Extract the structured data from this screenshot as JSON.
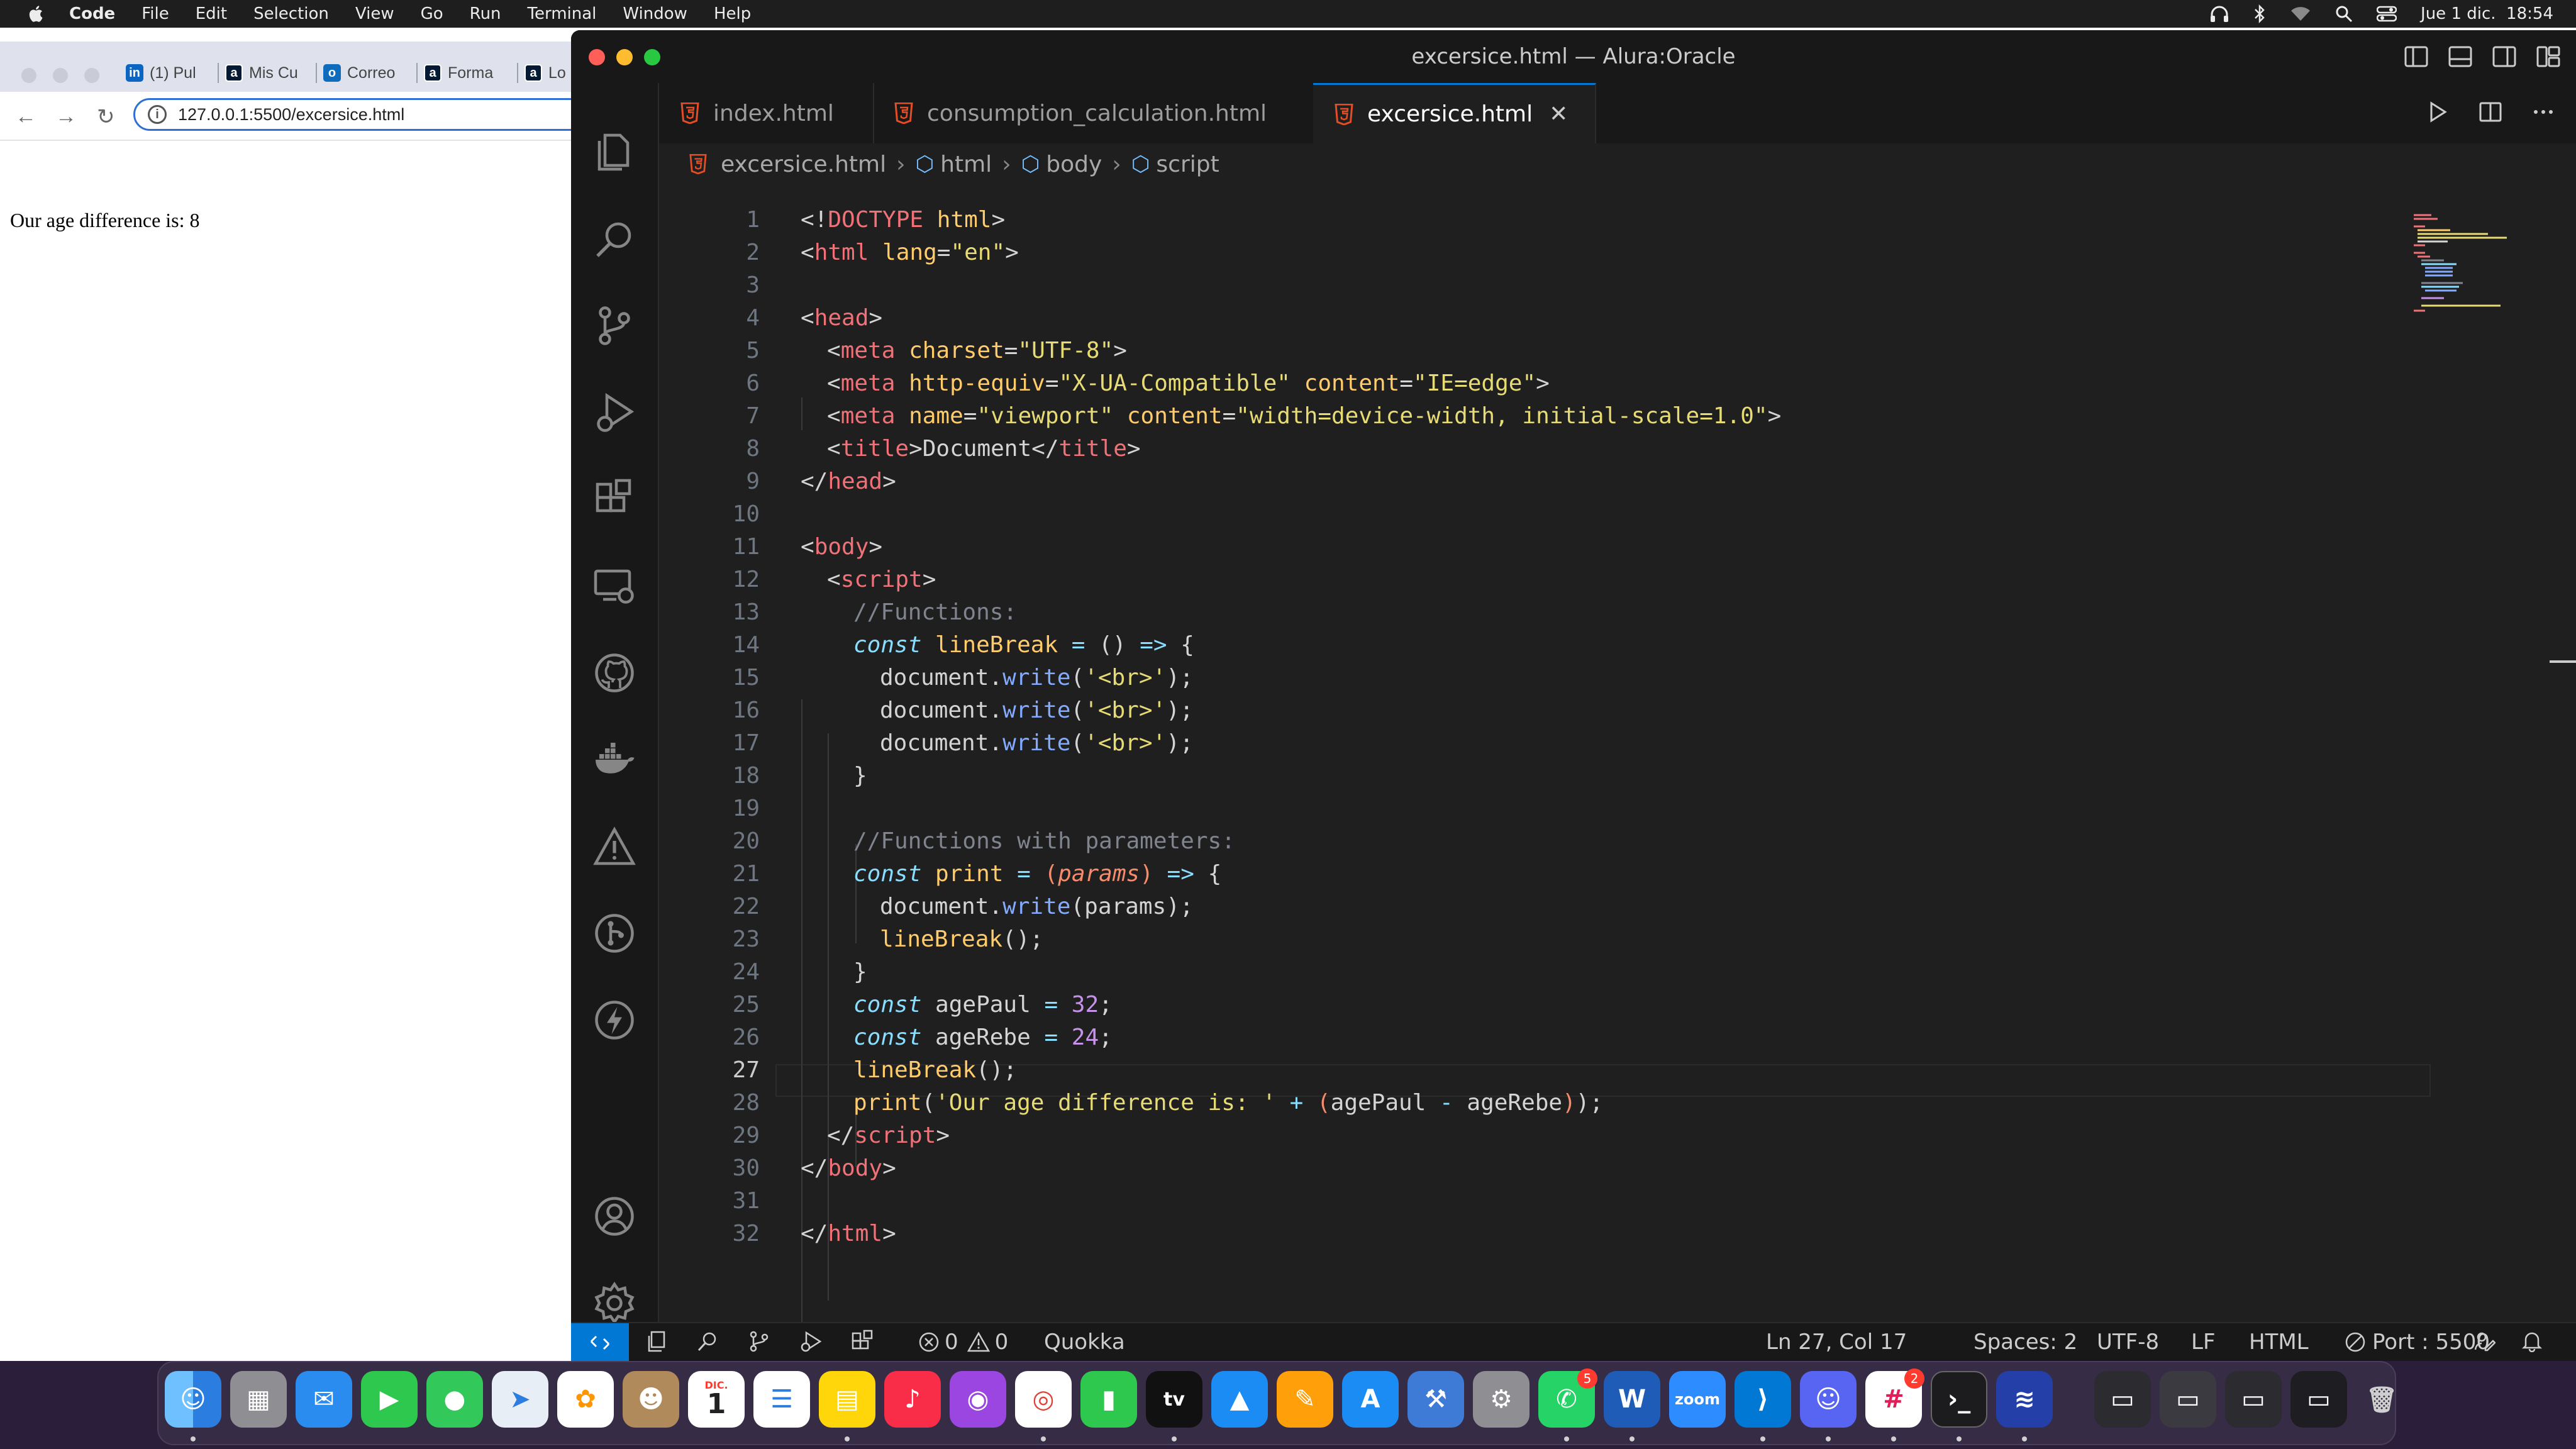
{
  "menubar": {
    "app_name": "Code",
    "items": [
      "File",
      "Edit",
      "Selection",
      "View",
      "Go",
      "Run",
      "Terminal",
      "Window",
      "Help"
    ],
    "clock": "Jue 1 dic.  18:54"
  },
  "browser": {
    "tabs": [
      {
        "label": "(1) Pul",
        "icon": "linkedin-icon",
        "color": "#0a66c2"
      },
      {
        "label": "Mis Cu",
        "icon": "alura-icon",
        "color": "#051933"
      },
      {
        "label": "Correo",
        "icon": "outlook-icon",
        "color": "#0f6cbd"
      },
      {
        "label": "Forma",
        "icon": "alura-icon",
        "color": "#051933"
      },
      {
        "label": "Lo",
        "icon": "alura-icon",
        "color": "#051933"
      }
    ],
    "url": "127.0.0.1:5500/excersice.html",
    "page_text": "Our age difference is: 8"
  },
  "vscode": {
    "title": "excersice.html — Alura:Oracle",
    "tabs": [
      {
        "label": "index.html"
      },
      {
        "label": "consumption_calculation.html"
      },
      {
        "label": "excersice.html",
        "active": true
      }
    ],
    "breadcrumb": [
      "excersice.html",
      "html",
      "body",
      "script"
    ],
    "line_numbers": [
      "1",
      "2",
      "3",
      "4",
      "5",
      "6",
      "7",
      "8",
      "9",
      "10",
      "11",
      "12",
      "13",
      "14",
      "15",
      "16",
      "17",
      "18",
      "19",
      "20",
      "21",
      "22",
      "23",
      "24",
      "25",
      "26",
      "27",
      "28",
      "29",
      "30",
      "31",
      "32"
    ],
    "code": {
      "l1": [
        "<!",
        "DOCTYPE",
        " html",
        ">"
      ],
      "l2": [
        "<",
        "html",
        " lang",
        "=",
        "\"en\"",
        ">"
      ],
      "l4": [
        "<",
        "head",
        ">"
      ],
      "l5": [
        "<",
        "meta",
        " charset",
        "=",
        "\"UTF-8\"",
        ">"
      ],
      "l6": [
        "<",
        "meta",
        " http-equiv",
        "=",
        "\"X-UA-Compatible\"",
        " content",
        "=",
        "\"IE=edge\"",
        ">"
      ],
      "l7": [
        "<",
        "meta",
        " name",
        "=",
        "\"viewport\"",
        " content",
        "=",
        "\"width=device-width, initial-scale=1.0\"",
        ">"
      ],
      "l8": [
        "<",
        "title",
        ">",
        "Document",
        "</",
        "title",
        ">"
      ],
      "l9": [
        "</",
        "head",
        ">"
      ],
      "l11": [
        "<",
        "body",
        ">"
      ],
      "l12": [
        "<",
        "script",
        ">"
      ],
      "l13": [
        "//Functions:"
      ],
      "l14": [
        "const",
        " lineBreak",
        " = ",
        "()",
        " => ",
        "{"
      ],
      "l15": [
        "document",
        ".",
        "write",
        "(",
        "'<br>'",
        ");"
      ],
      "l16": [
        "document",
        ".",
        "write",
        "(",
        "'<br>'",
        ");"
      ],
      "l17": [
        "document",
        ".",
        "write",
        "(",
        "'<br>'",
        ");"
      ],
      "l18": [
        "}"
      ],
      "l20": [
        "//Functions with parameters:"
      ],
      "l21": [
        "const",
        " print",
        " = ",
        "(",
        "params",
        ")",
        " => ",
        "{"
      ],
      "l22": [
        "document",
        ".",
        "write",
        "(",
        "params",
        ");"
      ],
      "l23": [
        "lineBreak",
        "();"
      ],
      "l24": [
        "}"
      ],
      "l25": [
        "const",
        " agePaul",
        " = ",
        "32",
        ";"
      ],
      "l26": [
        "const",
        " ageRebe",
        " = ",
        "24",
        ";"
      ],
      "l27": [
        "lineBreak",
        "();"
      ],
      "l28": [
        "print",
        "(",
        "'Our age difference is: '",
        " + ",
        "(",
        "agePaul",
        " - ",
        "ageRebe",
        ")",
        ");"
      ],
      "l29": [
        "</",
        "script",
        ">"
      ],
      "l30": [
        "</",
        "body",
        ">"
      ],
      "l32": [
        "</",
        "html",
        ">"
      ]
    },
    "status": {
      "errors": "0",
      "warnings": "0",
      "extension": "Quokka",
      "cursor": "Ln 27, Col 17",
      "spaces": "Spaces: 2",
      "encoding": "UTF-8",
      "eol": "LF",
      "language": "HTML",
      "port": "Port : 5500"
    }
  },
  "dock": {
    "badges": {
      "whatsapp": "5",
      "slack": "2"
    },
    "calendar_month": "DIC.",
    "calendar_day": "1",
    "appletv_label": "tv",
    "zoom_label": "zoom"
  },
  "colors": {
    "accent": "#0078d4",
    "editor_bg": "#1f1f1f",
    "chrome_bg": "#181818"
  }
}
